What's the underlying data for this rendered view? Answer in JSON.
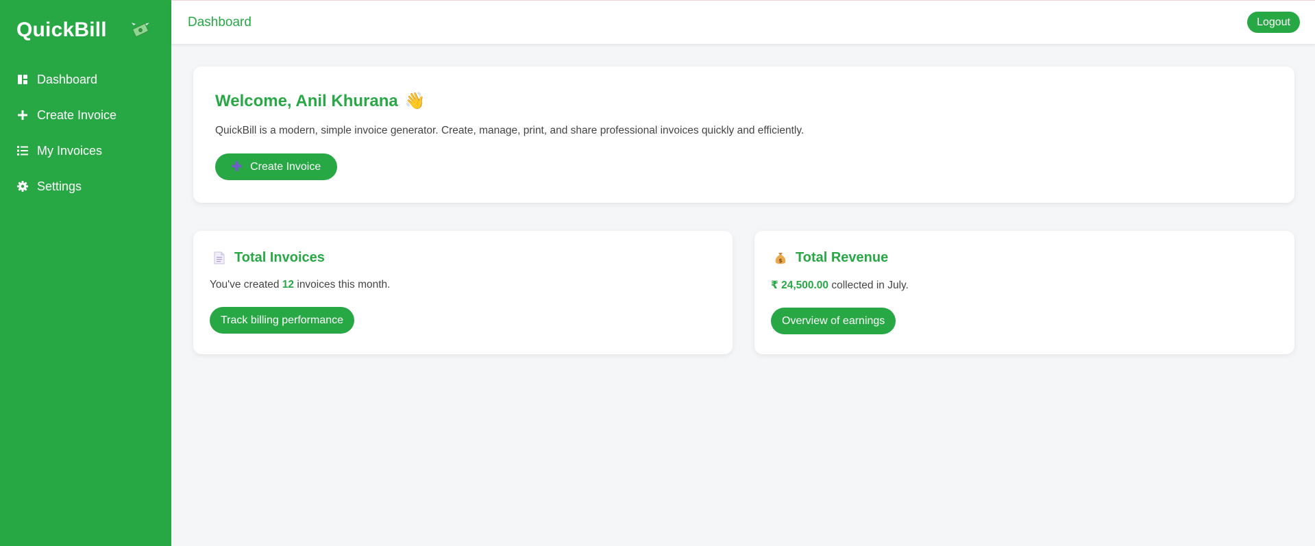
{
  "brand": {
    "name": "QuickBill",
    "icon": "flying-money-icon"
  },
  "sidebar": {
    "items": [
      {
        "label": "Dashboard",
        "icon": "dashboard-icon"
      },
      {
        "label": "Create Invoice",
        "icon": "plus-icon"
      },
      {
        "label": "My Invoices",
        "icon": "list-icon"
      },
      {
        "label": "Settings",
        "icon": "gear-icon"
      }
    ]
  },
  "topbar": {
    "title": "Dashboard",
    "logout_label": "Logout"
  },
  "welcome": {
    "greeting": "Welcome, Anil Khurana",
    "emoji": "👋",
    "description": "QuickBill is a modern, simple invoice generator. Create, manage, print, and share professional invoices quickly and efficiently.",
    "button_icon": "✚",
    "button_label": "Create Invoice"
  },
  "stats": {
    "invoices": {
      "title": "Total Invoices",
      "icon": "document-icon",
      "text_before": "You've created ",
      "count": "12",
      "text_after": " invoices this month.",
      "button_label": "Track billing performance"
    },
    "revenue": {
      "title": "Total Revenue",
      "icon": "money-bag-icon",
      "amount": "₹ 24,500.00",
      "text_after": " collected in July.",
      "button_label": "Overview of earnings"
    }
  },
  "colors": {
    "accent": "#28a745",
    "background": "#f5f6f8"
  }
}
